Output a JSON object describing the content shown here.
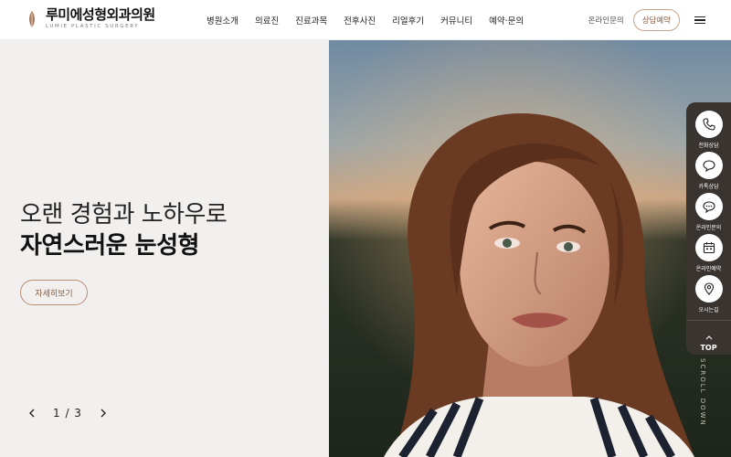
{
  "brand": {
    "name": "루미에성형외과의원",
    "subtitle": "LUMIE PLASTIC SURGERY"
  },
  "nav": {
    "items": [
      "병원소개",
      "의료진",
      "진료과목",
      "전후사진",
      "리얼후기",
      "커뮤니티",
      "예약·문의"
    ]
  },
  "util": {
    "online_inquiry": "온라인문의",
    "consult_button": "상담예약"
  },
  "hero": {
    "line1": "오랜 경험과 노하우로",
    "line2": "자연스러운 눈성형",
    "more_button": "자세히보기",
    "slide_counter": "1 / 3",
    "scroll_label": "SCROLL DOWN"
  },
  "quick_menu": {
    "items": [
      {
        "label": "전화상담",
        "icon": "phone-icon"
      },
      {
        "label": "카톡상담",
        "icon": "chat-bubble-icon"
      },
      {
        "label": "온라인문의",
        "icon": "message-icon"
      },
      {
        "label": "온라인예약",
        "icon": "calendar-icon"
      },
      {
        "label": "오시는길",
        "icon": "location-pin-icon"
      }
    ],
    "top_label": "TOP"
  },
  "colors": {
    "accent": "#8a5a3c",
    "accent_border": "#c8a48c",
    "panel_bg": "#f2f0ee",
    "quick_bg": "#3a3431"
  }
}
